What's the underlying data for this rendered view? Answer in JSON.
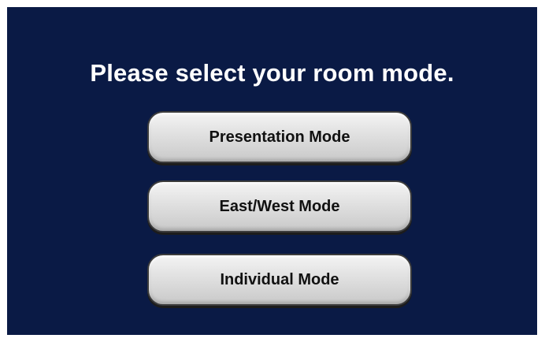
{
  "screen": {
    "title": "Please select your room mode.",
    "background_color": "#0a1a45"
  },
  "buttons": [
    {
      "label": "Presentation Mode"
    },
    {
      "label": "East/West Mode"
    },
    {
      "label": "Individual Mode"
    }
  ]
}
